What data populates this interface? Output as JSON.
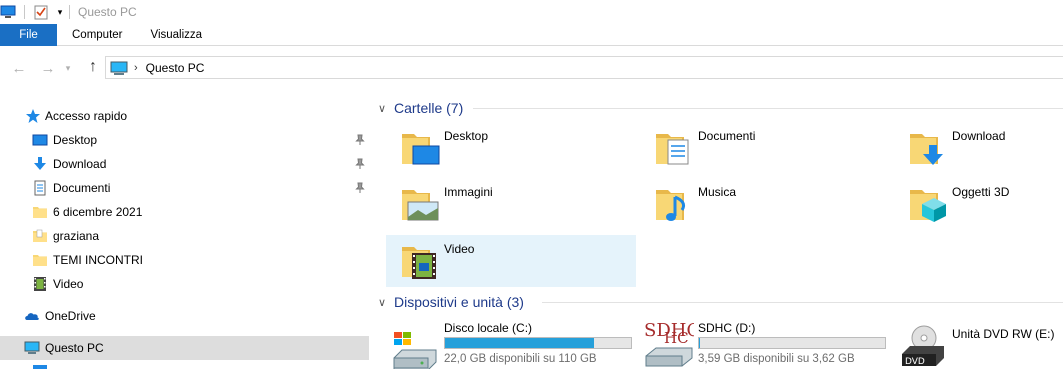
{
  "window": {
    "title": "Questo PC"
  },
  "ribbon": {
    "tabs": [
      "File",
      "Computer",
      "Visualizza"
    ]
  },
  "address": {
    "crumb": "Questo PC"
  },
  "sidebar": {
    "items": [
      {
        "label": "Accesso rapido",
        "icon": "star-icon"
      },
      {
        "label": "Desktop",
        "icon": "desktop-icon",
        "pinned": true
      },
      {
        "label": "Download",
        "icon": "download-icon",
        "pinned": true
      },
      {
        "label": "Documenti",
        "icon": "document-icon",
        "pinned": true
      },
      {
        "label": "6 dicembre 2021",
        "icon": "folder-icon"
      },
      {
        "label": "graziana",
        "icon": "folder-icon"
      },
      {
        "label": "TEMI INCONTRI",
        "icon": "folder-icon"
      },
      {
        "label": "Video",
        "icon": "video-icon"
      },
      {
        "label": "OneDrive",
        "icon": "cloud-icon"
      },
      {
        "label": "Questo PC",
        "icon": "pc-icon"
      }
    ]
  },
  "folders_group": {
    "title": "Cartelle (7)",
    "items": [
      {
        "label": "Desktop",
        "overlay": "desktop"
      },
      {
        "label": "Documenti",
        "overlay": "document"
      },
      {
        "label": "Download",
        "overlay": "download"
      },
      {
        "label": "Immagini",
        "overlay": "picture"
      },
      {
        "label": "Musica",
        "overlay": "music"
      },
      {
        "label": "Oggetti 3D",
        "overlay": "cube"
      },
      {
        "label": "Video",
        "overlay": "film"
      }
    ]
  },
  "drives_group": {
    "title": "Dispositivi e unità (3)",
    "items": [
      {
        "label": "Disco locale (C:)",
        "free": "22,0 GB disponibili su 110 GB",
        "used_fraction": 0.8,
        "icon": "hdd-icon"
      },
      {
        "label": "SDHC (D:)",
        "free": "3,59 GB disponibili su 3,62 GB",
        "used_fraction": 0.008,
        "icon": "sdhc-icon",
        "icon_text": "SDHC"
      },
      {
        "label": "Unità DVD RW (E:)",
        "icon": "dvd-icon",
        "icon_text": "DVD"
      }
    ]
  },
  "colors": {
    "accent": "#1a6fc4",
    "group_title": "#1e3a8a",
    "progress": "#26a0da",
    "hover": "#e5f3fb",
    "selected": "#dddddd"
  }
}
